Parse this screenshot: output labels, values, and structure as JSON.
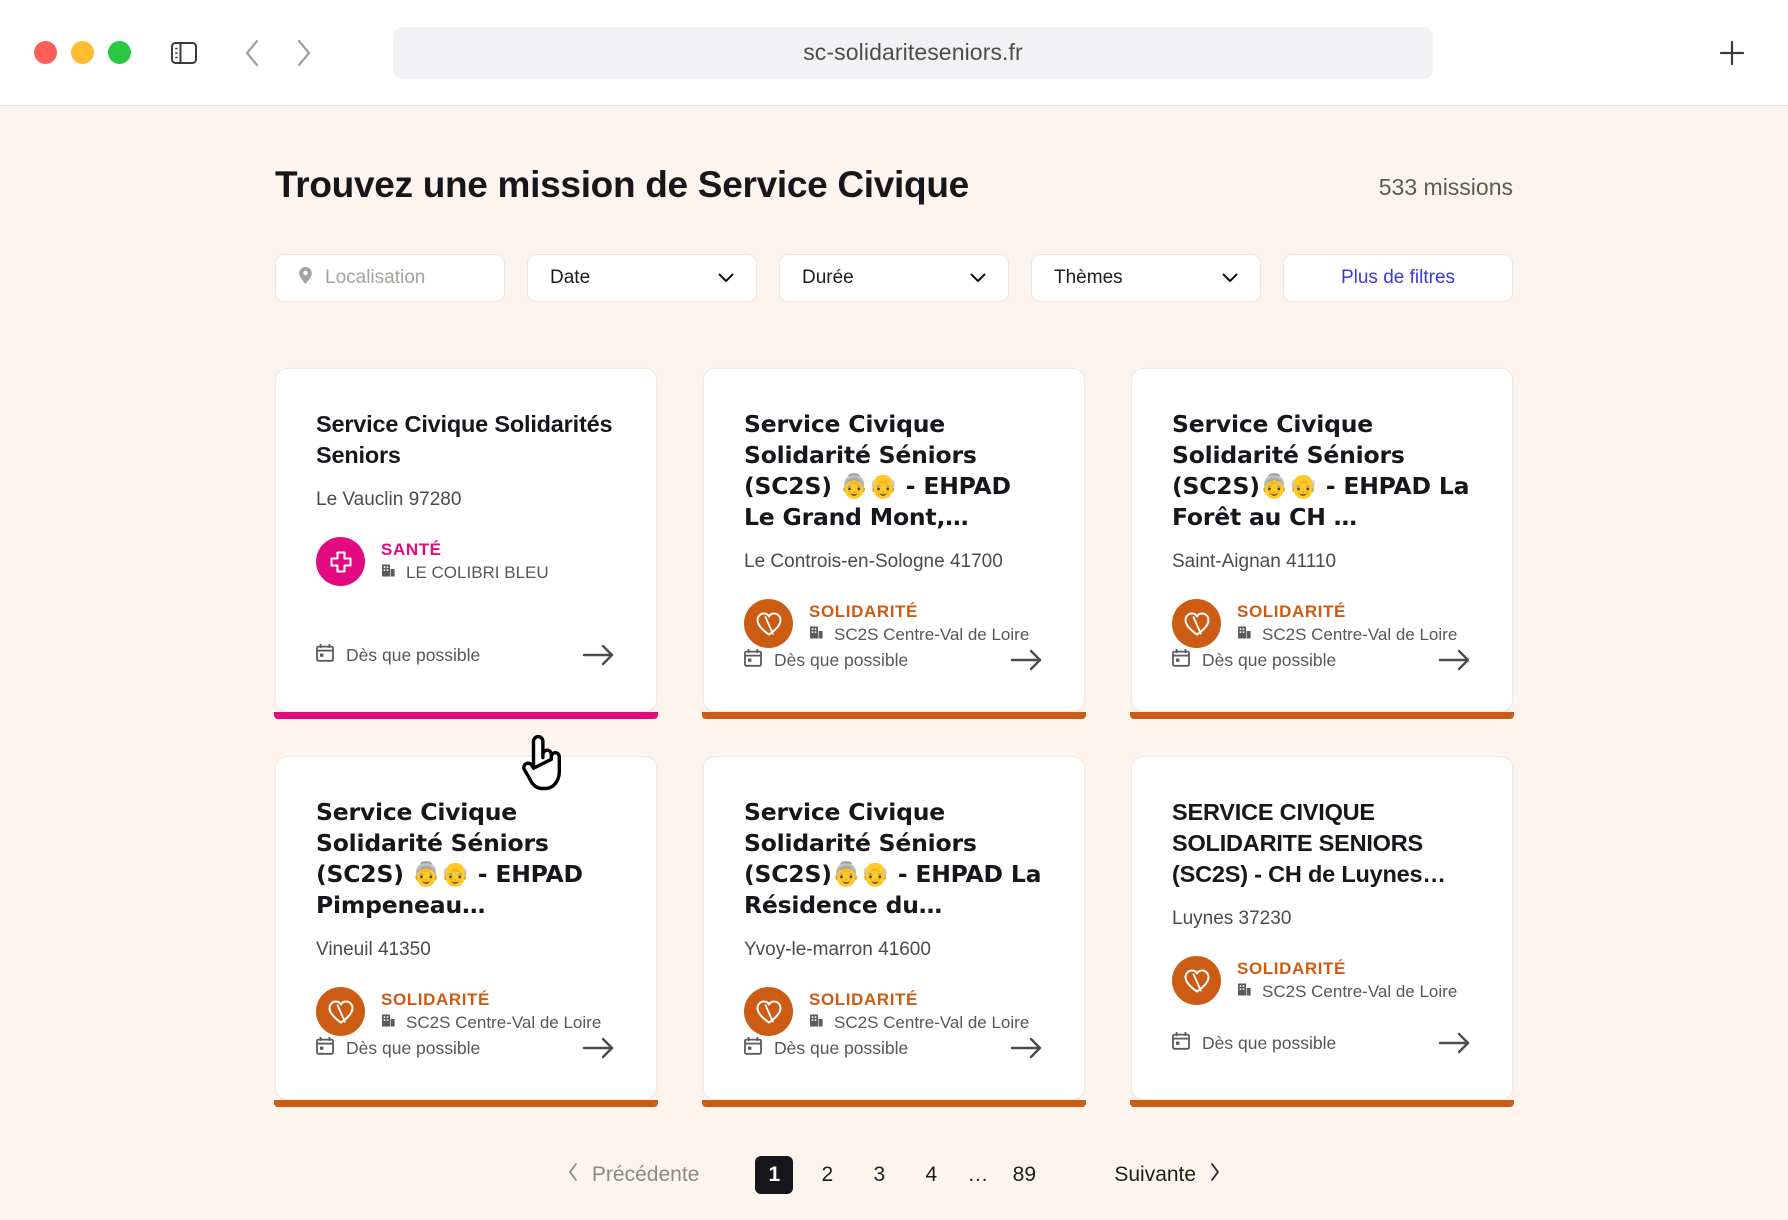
{
  "browser": {
    "url": "sc-solidariteseniors.fr",
    "traffic_lights": [
      "close",
      "minimize",
      "maximize"
    ],
    "icons": {
      "sidebar": "sidebar-toggle-icon",
      "back": "back-arrow-icon",
      "forward": "forward-arrow-icon",
      "new_tab": "+"
    }
  },
  "header": {
    "title": "Trouvez une mission de Service Civique",
    "mission_count": "533 missions"
  },
  "filters": {
    "location_placeholder": "Localisation",
    "date_label": "Date",
    "duree_label": "Durée",
    "themes_label": "Thèmes",
    "more_label": "Plus de filtres"
  },
  "colors": {
    "page_background": "#fdf4ed",
    "sante": "#e3097e",
    "solidarite": "#cc5c14",
    "link": "#3a3ad8",
    "text": "#16161b"
  },
  "cards": [
    {
      "title": "Service Civique Solidarités Seniors",
      "location": "Le Vauclin 97280",
      "domain": "SANTÉ",
      "domain_key": "sante",
      "organisation": "LE COLIBRI BLEU",
      "date": "Dès que possible",
      "accent": "#e3097e"
    },
    {
      "title": "Service Civique Solidarité Séniors (SC2S) 👵👴 - EHPAD Le Grand Mont,…",
      "location": "Le Controis-en-Sologne 41700",
      "domain": "SOLIDARITÉ",
      "domain_key": "solidarite",
      "organisation": "SC2S Centre-Val de Loire",
      "date": "Dès que possible",
      "accent": "#cc5c14"
    },
    {
      "title": "Service Civique Solidarité Séniors (SC2S)👵👴 - EHPAD La Forêt au CH …",
      "location": "Saint-Aignan 41110",
      "domain": "SOLIDARITÉ",
      "domain_key": "solidarite",
      "organisation": "SC2S Centre-Val de Loire",
      "date": "Dès que possible",
      "accent": "#cc5c14"
    },
    {
      "title": "Service Civique Solidarité Séniors (SC2S) 👵👴 - EHPAD Pimpeneau…",
      "location": "Vineuil 41350",
      "domain": "SOLIDARITÉ",
      "domain_key": "solidarite",
      "organisation": "SC2S Centre-Val de Loire",
      "date": "Dès que possible",
      "accent": "#cc5c14"
    },
    {
      "title": "Service Civique Solidarité Séniors (SC2S)👵👴 - EHPAD La Résidence du…",
      "location": "Yvoy-le-marron 41600",
      "domain": "SOLIDARITÉ",
      "domain_key": "solidarite",
      "organisation": "SC2S Centre-Val de Loire",
      "date": "Dès que possible",
      "accent": "#cc5c14"
    },
    {
      "title": "SERVICE CIVIQUE SOLIDARITE SENIORS (SC2S) - CH de Luynes…",
      "location": "Luynes 37230",
      "domain": "SOLIDARITÉ",
      "domain_key": "solidarite",
      "organisation": "SC2S Centre-Val de Loire",
      "date": "Dès que possible",
      "accent": "#cc5c14"
    }
  ],
  "pagination": {
    "previous": "Précédente",
    "next": "Suivante",
    "pages": [
      "1",
      "2",
      "3",
      "4",
      "…",
      "89"
    ],
    "current": "1"
  }
}
